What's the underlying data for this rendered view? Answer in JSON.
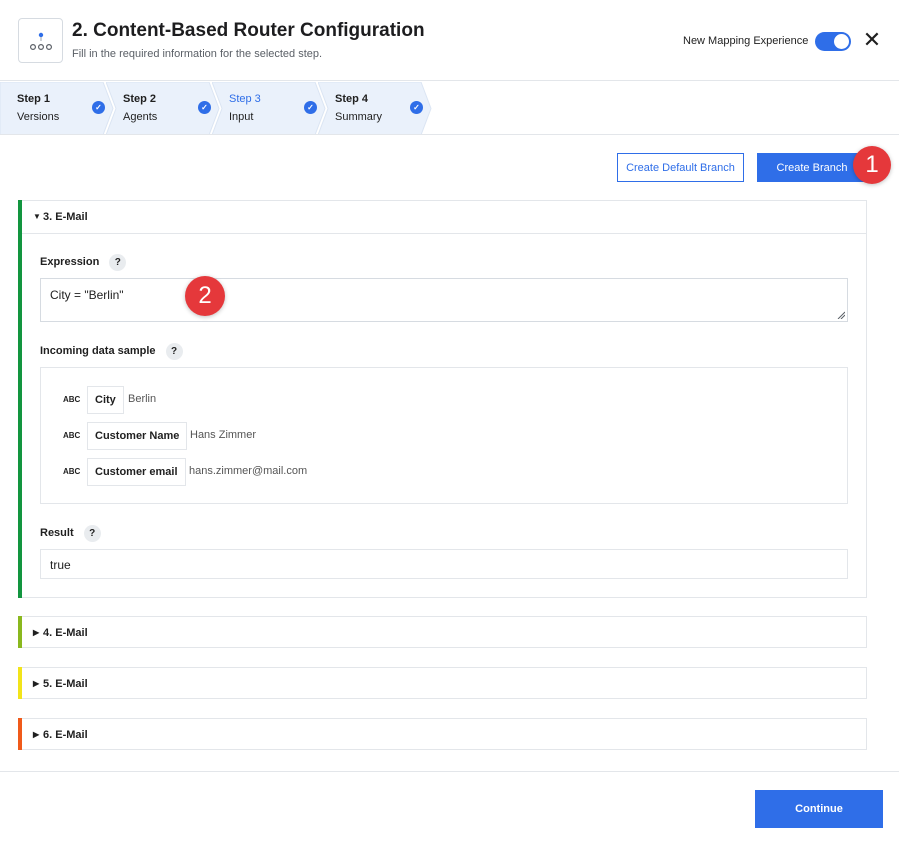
{
  "header": {
    "title": "2. Content-Based Router Configuration",
    "subtitle": "Fill in the required information for the selected step.",
    "toggle_label": "New Mapping Experience",
    "toggle_on": true,
    "close_glyph": "✕"
  },
  "steps": [
    {
      "title": "Step 1",
      "label": "Versions",
      "completed": true,
      "active": false
    },
    {
      "title": "Step 2",
      "label": "Agents",
      "completed": true,
      "active": false
    },
    {
      "title": "Step 3",
      "label": "Input",
      "completed": true,
      "active": true
    },
    {
      "title": "Step 4",
      "label": "Summary",
      "completed": true,
      "active": false
    }
  ],
  "actions": {
    "create_default_branch": "Create Default Branch",
    "create_branch": "Create Branch"
  },
  "annotations": {
    "badge_1": "1",
    "badge_2": "2"
  },
  "branches": [
    {
      "label": "3. E-Mail",
      "expanded": true,
      "accent_color": "#12953f",
      "expression_label": "Expression",
      "expression_value": "City = \"Berlin\"",
      "sample_label": "Incoming data sample",
      "sample_rows": [
        {
          "type": "ABC",
          "key": "City",
          "value": "Berlin"
        },
        {
          "type": "ABC",
          "key": "Customer Name",
          "value": "Hans Zimmer"
        },
        {
          "type": "ABC",
          "key": "Customer email",
          "value": "hans.zimmer@mail.com"
        }
      ],
      "result_label": "Result",
      "result_value": "true"
    },
    {
      "label": "4. E-Mail",
      "expanded": false,
      "accent_color": "#8ab81e"
    },
    {
      "label": "5. E-Mail",
      "expanded": false,
      "accent_color": "#f2e41a"
    },
    {
      "label": "6. E-Mail",
      "expanded": false,
      "accent_color": "#f05a1a"
    }
  ],
  "help_glyph": "?",
  "footer": {
    "continue": "Continue"
  },
  "colors": {
    "primary": "#2f6ee8",
    "badge": "#e5383b",
    "stepper_bg": "#eaf1fb"
  },
  "icons": {
    "app": "router-node-icon",
    "close": "close-icon",
    "step_complete": "check-circle-icon",
    "expanded": "caret-down-icon",
    "collapsed": "caret-right-icon"
  }
}
